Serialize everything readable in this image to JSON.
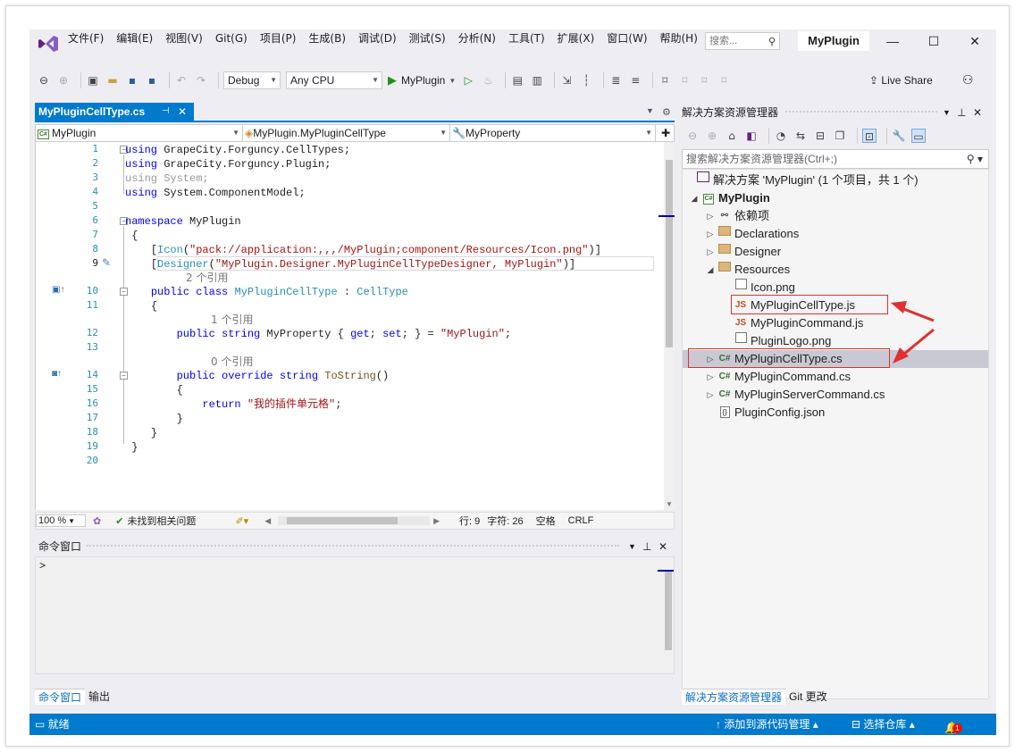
{
  "menu": {
    "items": [
      "文件(F)",
      "编辑(E)",
      "视图(V)",
      "Git(G)",
      "项目(P)",
      "生成(B)",
      "调试(D)",
      "测试(S)",
      "分析(N)",
      "工具(T)",
      "扩展(X)",
      "窗口(W)",
      "帮助(H)"
    ]
  },
  "search": {
    "placeholder": "搜索..."
  },
  "app_title": "MyPlugin",
  "window_controls": [
    "—",
    "☐",
    "✕"
  ],
  "toolbar": {
    "config": "Debug",
    "platform": "Any CPU",
    "run_target": "MyPlugin",
    "live_share": "Live Share"
  },
  "editor": {
    "tab_label": "MyPluginCellType.cs",
    "nav_project": "MyPlugin",
    "nav_type": "MyPlugin.MyPluginCellType",
    "nav_member": "MyProperty",
    "line_numbers": [
      "1",
      "2",
      "3",
      "4",
      "5",
      "6",
      "7",
      "8",
      "9",
      "",
      "10",
      "11",
      "",
      "12",
      "13",
      "",
      "14",
      "15",
      "16",
      "17",
      "18",
      "19",
      "20"
    ],
    "references": {
      "r10": "2 个引用",
      "r12": "1 个引用",
      "r14": "0 个引用"
    },
    "code": {
      "l1_kw": "using",
      "l1_rest": " GrapeCity.Forguncy.CellTypes;",
      "l2_kw": "using",
      "l2_rest": " GrapeCity.Forguncy.Plugin;",
      "l3": "using System;",
      "l4_kw": "using",
      "l4_rest": " System.ComponentModel;",
      "l6_kw": "namespace",
      "l6_rest": " MyPlugin",
      "l7": "{",
      "l8_a": "[",
      "l8_type": "Icon",
      "l8_str": "\"pack://application:,,,/MyPlugin;component/Resources/Icon.png\"",
      "l8_b": ")]",
      "l8_open": "(",
      "l9_a": "[",
      "l9_type": "Designer",
      "l9_open": "(",
      "l9_str": "\"MyPlugin.Designer.MyPluginCellTypeDesigner, MyPlugin\"",
      "l9_b": ")]",
      "l10_kw": "public class",
      "l10_type": "MyPluginCellType",
      "l10_mid": " : ",
      "l10_base": "CellType",
      "l11": "{",
      "l12_kw": "public string",
      "l12_rest": " MyProperty { ",
      "l12_get": "get",
      "l12_semi1": "; ",
      "l12_set": "set",
      "l12_close": "; } = ",
      "l12_str": "\"MyPlugin\"",
      "l12_end": ";",
      "l14_kw": "public override string",
      "l14_name": " ToString",
      "l14_end": "()",
      "l15": "{",
      "l16_kw": "return",
      "l16_str": " \"我的插件单元格\"",
      "l16_end": ";",
      "l17": "}",
      "l18": "}",
      "l19": "}"
    },
    "status": {
      "zoom": "100 %",
      "issues": "未找到相关问题",
      "line": "行: 9",
      "col": "字符: 26",
      "spaces": "空格",
      "eol": "CRLF"
    }
  },
  "command_window": {
    "title": "命令窗口",
    "prompt": ">",
    "tabs": [
      "命令窗口",
      "输出"
    ]
  },
  "solution_explorer": {
    "title": "解决方案资源管理器",
    "search_placeholder": "搜索解决方案资源管理器(Ctrl+;)",
    "tree": [
      {
        "label": "解决方案 'MyPlugin' (1 个项目，共 1 个)",
        "icon": "solution-icon"
      },
      {
        "label": "MyPlugin",
        "icon": "csharp-project-icon"
      },
      {
        "label": "依赖项",
        "icon": "dependencies-icon"
      },
      {
        "label": "Declarations",
        "icon": "folder-icon"
      },
      {
        "label": "Designer",
        "icon": "folder-icon"
      },
      {
        "label": "Resources",
        "icon": "folder-icon"
      },
      {
        "label": "Icon.png",
        "icon": "image-icon"
      },
      {
        "label": "MyPluginCellType.js",
        "icon": "js-file-icon"
      },
      {
        "label": "MyPluginCommand.js",
        "icon": "js-file-icon"
      },
      {
        "label": "PluginLogo.png",
        "icon": "image-icon"
      },
      {
        "label": "MyPluginCellType.cs",
        "icon": "cs-file-icon"
      },
      {
        "label": "MyPluginCommand.cs",
        "icon": "cs-file-icon"
      },
      {
        "label": "MyPluginServerCommand.cs",
        "icon": "cs-file-icon"
      },
      {
        "label": "PluginConfig.json",
        "icon": "json-file-icon"
      }
    ],
    "tabs": [
      "解决方案资源管理器",
      "Git 更改"
    ]
  },
  "statusbar": {
    "ready": "就绪",
    "add_source": "添加到源代码管理",
    "select_repo": "选择仓库",
    "notifications": "1"
  },
  "colors": {
    "accent": "#007acc",
    "annotation": "#e03030"
  }
}
